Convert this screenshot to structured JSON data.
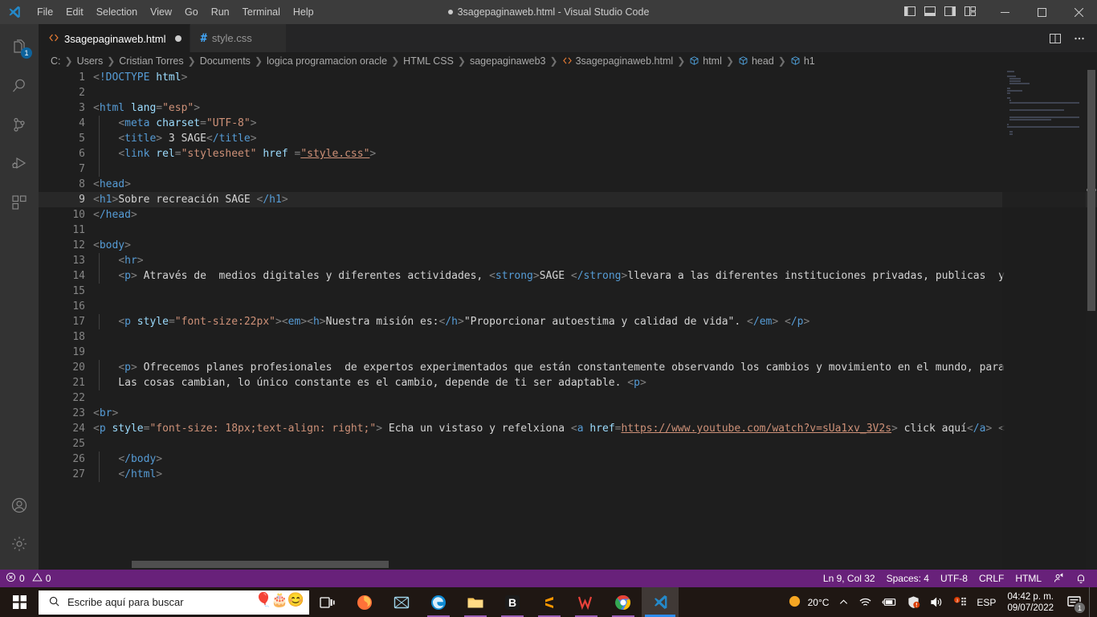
{
  "window": {
    "title": "3sagepaginaweb.html - Visual Studio Code",
    "dirty_indicator": "●",
    "minimize": "—",
    "maximize": "▢",
    "close": "✕"
  },
  "menubar": {
    "items": [
      "File",
      "Edit",
      "Selection",
      "View",
      "Go",
      "Run",
      "Terminal",
      "Help"
    ]
  },
  "activitybar": {
    "items": [
      {
        "name": "explorer",
        "badge": "1"
      },
      {
        "name": "search",
        "badge": ""
      },
      {
        "name": "source-control",
        "badge": ""
      },
      {
        "name": "run-and-debug",
        "badge": ""
      },
      {
        "name": "extensions",
        "badge": ""
      }
    ],
    "bottom": [
      {
        "name": "accounts"
      },
      {
        "name": "settings"
      }
    ]
  },
  "tabs": [
    {
      "label": "3sagepaginaweb.html",
      "icon": "html-icon",
      "active": true,
      "dirty": true
    },
    {
      "label": "style.css",
      "icon": "css-icon",
      "active": false,
      "dirty": false
    }
  ],
  "tab_actions": {
    "split_editor": "split-editor-icon",
    "more_actions": "ellipsis-icon"
  },
  "breadcrumbs": [
    {
      "label": "C:",
      "icon": ""
    },
    {
      "label": "Users",
      "icon": ""
    },
    {
      "label": "Cristian Torres",
      "icon": ""
    },
    {
      "label": "Documents",
      "icon": ""
    },
    {
      "label": "logica programacion oracle",
      "icon": ""
    },
    {
      "label": "HTML CSS",
      "icon": ""
    },
    {
      "label": "sagepaginaweb3",
      "icon": ""
    },
    {
      "label": "3sagepaginaweb.html",
      "icon": "html-icon"
    },
    {
      "label": "html",
      "icon": "symbol-icon"
    },
    {
      "label": "head",
      "icon": "symbol-icon"
    },
    {
      "label": "h1",
      "icon": "symbol-icon"
    }
  ],
  "editor": {
    "active_line": 9,
    "lines": [
      {
        "n": 1,
        "indent": 0,
        "text": "<!DOCTYPE html>"
      },
      {
        "n": 2,
        "indent": 0,
        "text": ""
      },
      {
        "n": 3,
        "indent": 0,
        "text": "<html lang=\"esp\">"
      },
      {
        "n": 4,
        "indent": 1,
        "text": "    <meta charset=\"UTF-8\">"
      },
      {
        "n": 5,
        "indent": 1,
        "text": "    <title> 3 SAGE</title>"
      },
      {
        "n": 6,
        "indent": 1,
        "text": "    <link rel=\"stylesheet\" href =\"style.css\">"
      },
      {
        "n": 7,
        "indent": 1,
        "text": ""
      },
      {
        "n": 8,
        "indent": 0,
        "text": "<head>"
      },
      {
        "n": 9,
        "indent": 0,
        "text": "<h1>Sobre recreación SAGE </h1>"
      },
      {
        "n": 10,
        "indent": 0,
        "text": "</head>"
      },
      {
        "n": 11,
        "indent": 0,
        "text": ""
      },
      {
        "n": 12,
        "indent": 0,
        "text": "<body>"
      },
      {
        "n": 13,
        "indent": 1,
        "text": "    <hr>"
      },
      {
        "n": 14,
        "indent": 1,
        "text": "    <p> Através de  medios digitales y diferentes actividades, <strong>SAGE </strong>llevara a las diferentes instituciones privadas, publicas  y"
      },
      {
        "n": 15,
        "indent": 0,
        "text": ""
      },
      {
        "n": 16,
        "indent": 0,
        "text": ""
      },
      {
        "n": 17,
        "indent": 1,
        "text": "    <p style=\"font-size:22px\"><em><h>Nuestra misión es:</h>\"Proporcionar autoestima y calidad de vida\". </em> </p>"
      },
      {
        "n": 18,
        "indent": 0,
        "text": ""
      },
      {
        "n": 19,
        "indent": 0,
        "text": ""
      },
      {
        "n": 20,
        "indent": 1,
        "text": "    <p> Ofrecemos planes profesionales  de expertos experimentados que están constantemente observando los cambios y movimiento en el mundo, para"
      },
      {
        "n": 21,
        "indent": 1,
        "text": "    Las cosas cambian, lo único constante es el cambio, depende de ti ser adaptable. <p>"
      },
      {
        "n": 22,
        "indent": 0,
        "text": ""
      },
      {
        "n": 23,
        "indent": 0,
        "text": "<br>"
      },
      {
        "n": 24,
        "indent": 0,
        "text": "<p style=\"font-size: 18px;text-align: right;\"> Echa un vistaso y refelxiona <a href=https://www.youtube.com/watch?v=sUa1xv_3V2s> click aquí</a> <"
      },
      {
        "n": 25,
        "indent": 0,
        "text": ""
      },
      {
        "n": 26,
        "indent": 1,
        "text": "    </body>"
      },
      {
        "n": 27,
        "indent": 1,
        "text": "    </html>"
      }
    ]
  },
  "statusbar": {
    "errors": "0",
    "warnings": "0",
    "cursor": "Ln 9, Col 32",
    "indentation": "Spaces: 4",
    "encoding": "UTF-8",
    "eol": "CRLF",
    "language": "HTML",
    "feedback_icon": "smiley-icon",
    "bell_icon": "bell-icon"
  },
  "taskbar": {
    "start_icon": "windows-start-icon",
    "search_placeholder": "Escribe aquí para buscar",
    "search_value": "",
    "apps": [
      {
        "name": "task-view"
      },
      {
        "name": "firefox"
      },
      {
        "name": "screen-capture"
      },
      {
        "name": "microsoft-edge"
      },
      {
        "name": "file-explorer"
      },
      {
        "name": "blackboard"
      },
      {
        "name": "sublime-text"
      },
      {
        "name": "wondershare"
      },
      {
        "name": "google-chrome"
      },
      {
        "name": "visual-studio-code"
      }
    ],
    "tray": {
      "weather_temp": "20°C",
      "chevron": "⌃",
      "wifi": "wifi-icon",
      "battery": "battery-icon",
      "security": "security-icon",
      "volume": "volume-icon",
      "onedrive": "onedrive-icon",
      "language": "ESP",
      "time": "04:42 p. m.",
      "date": "09/07/2022",
      "notification_count": "1"
    }
  },
  "colors": {
    "accent_purple": "#68217a",
    "tag_blue": "#569cd6",
    "attr_blue": "#9cdcfe",
    "string_orange": "#ce9178",
    "editor_bg": "#1e1e1e",
    "badge_blue": "#0e639c"
  }
}
